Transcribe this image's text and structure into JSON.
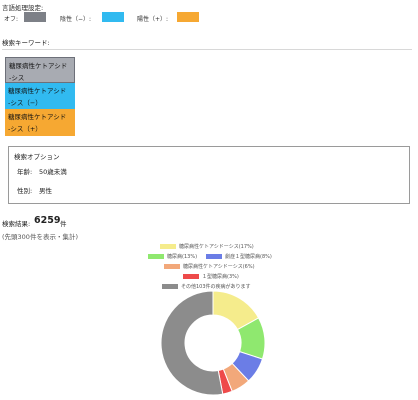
{
  "lang_settings": {
    "title": "言語処理設定:",
    "off_label": "オフ:",
    "neg_label": "陰性（−）:",
    "pos_label": "陽性（+）:",
    "off_color": "#7d8087",
    "neg_color": "#31baf0",
    "pos_color": "#f6a832"
  },
  "keywords": {
    "title": "検索キーワード:",
    "items": [
      {
        "text": "糖尿病性ケトアシド\n-シス",
        "state": "off"
      },
      {
        "text": "糖尿病性ケトアシド\n-シス（−）",
        "state": "negative"
      },
      {
        "text": "糖尿病性ケトアシド\n-シス（+）",
        "state": "positive"
      }
    ]
  },
  "options": {
    "title": "検索オプション",
    "age_label": "年齢:",
    "age_value": "50歳未満",
    "sex_label": "性別:",
    "sex_value": "男性"
  },
  "results": {
    "label": "検索結果:",
    "count": "6259",
    "unit": "件",
    "note": "(先頭300件を表示・集計)"
  },
  "chart_data": {
    "type": "pie",
    "donut": true,
    "categories": [
      "糖尿病性ケトアシドーシス",
      "糖尿病",
      "劇症１型糖尿病",
      "糖尿病性ケトアシドーシス",
      "１型糖尿病",
      "その他103件の疾病があります"
    ],
    "legend_labels": [
      "糖尿病性ケトアシドーシス(17%)",
      "糖尿病(13%)",
      "劇症１型糖尿病(8%)",
      "糖尿病性ケトアシドーシス(6%)",
      "１型糖尿病(3%)",
      "その他103件の疾病があります"
    ],
    "values": [
      17,
      13,
      8,
      6,
      3,
      53
    ],
    "colors": [
      "#f5ec8c",
      "#8fe86f",
      "#6b7de6",
      "#f2a87a",
      "#ee4a4a",
      "#8c8c8c"
    ]
  }
}
